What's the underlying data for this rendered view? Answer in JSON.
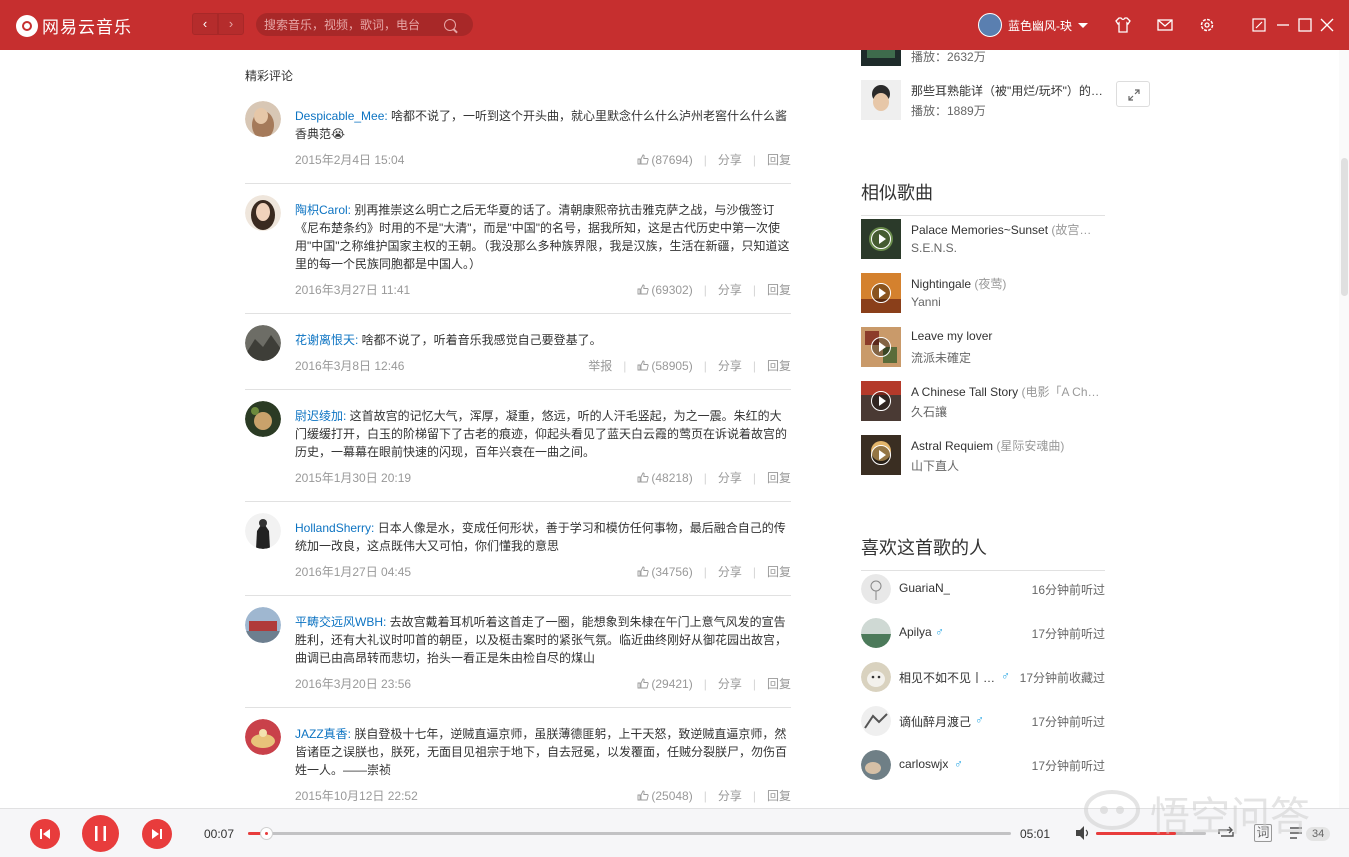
{
  "app": {
    "name": "网易云音乐"
  },
  "search": {
    "placeholder": "搜索音乐，视频，歌词，电台"
  },
  "user": {
    "name": "蓝色幽风-玦"
  },
  "colors": {
    "brand": "#c62f2f",
    "accent": "#e83c3c",
    "link": "#0c73c2",
    "male": "#26a6e4"
  },
  "comments_section": {
    "label": "精彩评论",
    "items": [
      {
        "user": "Despicable_Mee:",
        "text": " 啥都不说了，一听到这个开头曲，就心里默念什么什么泸州老窖什么什么酱香典范😭",
        "date": "2015年2月4日 15:04",
        "likes": "(87694)",
        "report": "",
        "share": "分享",
        "reply": "回复"
      },
      {
        "user": "陶枳Carol:",
        "text": " 别再推崇这么明亡之后无华夏的话了。清朝康熙帝抗击雅克萨之战，与沙俄签订《尼布楚条约》时用的不是\"大清\"，而是\"中国\"的名号，据我所知，这是古代历史中第一次使用\"中国\"之称维护国家主权的王朝。（我没那么多种族界限，我是汉族，生活在新疆，只知道这里的每一个民族同胞都是中国人。）",
        "date": "2016年3月27日 11:41",
        "likes": "(69302)",
        "report": "",
        "share": "分享",
        "reply": "回复"
      },
      {
        "user": "花谢离恨天:",
        "text": " 啥都不说了，听着音乐我感觉自己要登基了。",
        "date": "2016年3月8日 12:46",
        "likes": "(58905)",
        "report": "举报",
        "share": "分享",
        "reply": "回复"
      },
      {
        "user": "尉迟绫加:",
        "text": " 这首故宫的记忆大气，浑厚，凝重，悠远，听的人汗毛竖起，为之一震。朱红的大门缓缓打开，白玉的阶梯留下了古老的痕迹，仰起头看见了蓝天白云霞的莺页在诉说着故宫的历史，一幕幕在眼前快速的闪现，百年兴衰在一曲之间。",
        "date": "2015年1月30日 20:19",
        "likes": "(48218)",
        "report": "",
        "share": "分享",
        "reply": "回复"
      },
      {
        "user": "HollandSherry:",
        "text": " 日本人像是水，变成任何形状，善于学习和模仿任何事物，最后融合自己的传统加一改良，这点既伟大又可怕，你们懂我的意思",
        "date": "2016年1月27日 04:45",
        "likes": "(34756)",
        "report": "",
        "share": "分享",
        "reply": "回复"
      },
      {
        "user": "平畴交远风WBH:",
        "text": " 去故宫戴着耳机听着这首走了一圈，能想象到朱棣在午门上意气风发的宣告胜利，还有大礼议时叩首的朝臣，以及梃击案时的紧张气氛。临近曲终刚好从御花园出故宫，曲调已由高昂转而悲切，抬头一看正是朱由检自尽的煤山",
        "date": "2016年3月20日 23:56",
        "likes": "(29421)",
        "report": "",
        "share": "分享",
        "reply": "回复"
      },
      {
        "user": "JAZZ真香:",
        "text": " 朕自登极十七年，逆贼直逼京师，虽朕薄德匪躬，上干天怒，致逆贼直逼京师，然皆诸臣之误朕也，朕死，无面目见祖宗于地下，自去冠冕，以发覆面，任贼分裂朕尸，勿伤百姓一人。——崇祯",
        "date": "2015年10月12日 22:52",
        "likes": "(25048)",
        "report": "",
        "share": "分享",
        "reply": "回复"
      }
    ]
  },
  "mvs": [
    {
      "title": "",
      "plays": "播放：2632万"
    },
    {
      "title": "那些耳熟能详（被\"用烂/玩坏\"）的…",
      "plays": "播放：1889万"
    }
  ],
  "similar": {
    "heading": "相似歌曲",
    "songs": [
      {
        "name": "Palace Memories~Sunset",
        "alias": " (故宫…",
        "artist": "S.E.N.S."
      },
      {
        "name": "Nightingale",
        "alias": " (夜莺)",
        "artist": "Yanni"
      },
      {
        "name": "Leave my lover",
        "alias": "",
        "artist": "流派未確定"
      },
      {
        "name": "A Chinese Tall Story",
        "alias": " (电影「A Ch…",
        "artist": "久石讓"
      },
      {
        "name": "Astral Requiem",
        "alias": " (星际安魂曲)",
        "artist": "山下直人"
      }
    ]
  },
  "listeners": {
    "heading": "喜欢这首歌的人",
    "items": [
      {
        "name": "GuariaN_",
        "gender": "",
        "time": "16分钟前听过"
      },
      {
        "name": "Apilya",
        "gender": "♂",
        "time": "17分钟前听过"
      },
      {
        "name": "相见不如不见丨…",
        "gender": "♂",
        "time": "17分钟前收藏过"
      },
      {
        "name": "谪仙醉月渡己",
        "gender": "♂",
        "time": "17分钟前听过"
      },
      {
        "name": "carloswjx",
        "gender": "♂",
        "time": "17分钟前听过"
      }
    ]
  },
  "player": {
    "current_time": "00:07",
    "total_time": "05:01",
    "progress": 0.023,
    "volume": 0.73,
    "lyric_label": "词",
    "playlist_count": "34"
  },
  "watermark": {
    "text": "悟空问答"
  }
}
